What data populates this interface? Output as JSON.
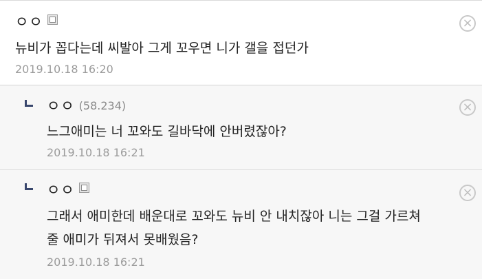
{
  "comments": [
    {
      "author": "ㅇㅇ",
      "ip": "",
      "body_lines": [
        "뉴비가 꼽다는데 씨발아 그게 꼬우면 니가 갤을 접던가"
      ],
      "timestamp": "2019.10.18 16:20",
      "delete_label": "×"
    },
    {
      "author": "ㅇㅇ",
      "ip": "(58.234)",
      "body_lines": [
        "느그애미는 너 꼬와도 길바닥에 안버렸잖아?"
      ],
      "timestamp": "2019.10.18 16:21",
      "delete_label": "×"
    },
    {
      "author": "ㅇㅇ",
      "ip": "",
      "body_lines": [
        "그래서 애미한데 배운대로 꼬와도 뉴비 안 내치잖아 니는 그걸 가르쳐",
        "줄 애미가 뒤져서 못배웠음?"
      ],
      "timestamp": "2019.10.18 16:21",
      "delete_label": "×"
    }
  ],
  "colors": {
    "reply_arrow": "#39476d",
    "reply_background": "#f7f7f7",
    "timestamp": "#9b9b9b",
    "ip": "#8a8a8a"
  },
  "icons": [
    "fixed-nick-icon",
    "reply-arrow-icon",
    "close-circle-icon"
  ]
}
